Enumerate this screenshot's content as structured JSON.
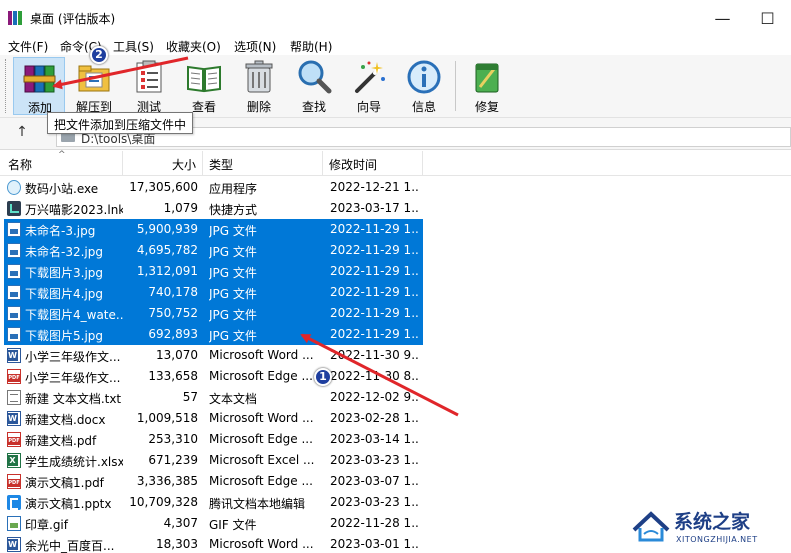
{
  "window": {
    "title": "桌面 (评估版本)",
    "minimize": "—",
    "maximize": "☐"
  },
  "menu": [
    "文件(F)",
    "命令(C)",
    "工具(S)",
    "收藏夹(O)",
    "选项(N)",
    "帮助(H)"
  ],
  "toolbar": {
    "buttons": [
      {
        "label": "添加",
        "icon": "winrar-books-icon"
      },
      {
        "label": "解压到",
        "icon": "folder-extract-icon"
      },
      {
        "label": "测试",
        "icon": "clipboard-check-icon"
      },
      {
        "label": "查看",
        "icon": "open-book-icon"
      },
      {
        "label": "删除",
        "icon": "trash-can-icon"
      },
      {
        "label": "查找",
        "icon": "magnifier-icon"
      },
      {
        "label": "向导",
        "icon": "magic-wand-icon"
      },
      {
        "label": "信息",
        "icon": "info-icon"
      },
      {
        "label": "修复",
        "icon": "repair-kit-icon"
      }
    ],
    "tooltip": "把文件添加到压缩文件中"
  },
  "address": {
    "path": "D:\\tools\\桌面"
  },
  "columns": {
    "name": "名称",
    "size": "大小",
    "type": "类型",
    "modified": "修改时间"
  },
  "files": [
    {
      "name": "数码小站.exe",
      "size": "17,305,600",
      "type": "应用程序",
      "modified": "2022-12-21 1...",
      "icon": "exe",
      "selected": false
    },
    {
      "name": "万兴喵影2023.lnk",
      "size": "1,079",
      "type": "快捷方式",
      "modified": "2023-03-17 1...",
      "icon": "lnk",
      "selected": false
    },
    {
      "name": "未命名-3.jpg",
      "size": "5,900,939",
      "type": "JPG 文件",
      "modified": "2022-11-29 1...",
      "icon": "jpg",
      "selected": true
    },
    {
      "name": "未命名-32.jpg",
      "size": "4,695,782",
      "type": "JPG 文件",
      "modified": "2022-11-29 1...",
      "icon": "jpg",
      "selected": true
    },
    {
      "name": "下载图片3.jpg",
      "size": "1,312,091",
      "type": "JPG 文件",
      "modified": "2022-11-29 1...",
      "icon": "jpg",
      "selected": true
    },
    {
      "name": "下载图片4.jpg",
      "size": "740,178",
      "type": "JPG 文件",
      "modified": "2022-11-29 1...",
      "icon": "jpg",
      "selected": true
    },
    {
      "name": "下载图片4_wate...",
      "size": "750,752",
      "type": "JPG 文件",
      "modified": "2022-11-29 1...",
      "icon": "jpg",
      "selected": true
    },
    {
      "name": "下载图片5.jpg",
      "size": "692,893",
      "type": "JPG 文件",
      "modified": "2022-11-29 1...",
      "icon": "jpg",
      "selected": true
    },
    {
      "name": "小学三年级作文...",
      "size": "13,070",
      "type": "Microsoft Word ...",
      "modified": "2022-11-30 9...",
      "icon": "word",
      "selected": false
    },
    {
      "name": "小学三年级作文...",
      "size": "133,658",
      "type": "Microsoft Edge ...",
      "modified": "2022-11-30 8...",
      "icon": "pdf",
      "selected": false
    },
    {
      "name": "新建 文本文档.txt",
      "size": "57",
      "type": "文本文档",
      "modified": "2022-12-02 9...",
      "icon": "txt",
      "selected": false
    },
    {
      "name": "新建文档.docx",
      "size": "1,009,518",
      "type": "Microsoft Word ...",
      "modified": "2023-02-28 1...",
      "icon": "word",
      "selected": false
    },
    {
      "name": "新建文档.pdf",
      "size": "253,310",
      "type": "Microsoft Edge ...",
      "modified": "2023-03-14 1...",
      "icon": "pdf",
      "selected": false
    },
    {
      "name": "学生成绩统计.xlsx",
      "size": "671,239",
      "type": "Microsoft Excel ...",
      "modified": "2023-03-23 1...",
      "icon": "excel",
      "selected": false
    },
    {
      "name": "演示文稿1.pdf",
      "size": "3,336,385",
      "type": "Microsoft Edge ...",
      "modified": "2023-03-07 1...",
      "icon": "pdf",
      "selected": false
    },
    {
      "name": "演示文稿1.pptx",
      "size": "10,709,328",
      "type": "腾讯文档本地编辑",
      "modified": "2023-03-23 1...",
      "icon": "pptx",
      "selected": false
    },
    {
      "name": "印章.gif",
      "size": "4,307",
      "type": "GIF 文件",
      "modified": "2022-11-28 1...",
      "icon": "gif",
      "selected": false
    },
    {
      "name": "余光中_百度百...",
      "size": "18,303",
      "type": "Microsoft Word ...",
      "modified": "2023-03-01 1...",
      "icon": "word",
      "selected": false
    }
  ],
  "annotations": {
    "badge1": "1",
    "badge2": "2",
    "arrow_color": "#e0262a"
  },
  "watermark": {
    "text": "系统之家",
    "sub": "XITONGZHIJIA.NET"
  },
  "colors": {
    "selection": "#0078d7",
    "badge": "#1f3f9f"
  }
}
